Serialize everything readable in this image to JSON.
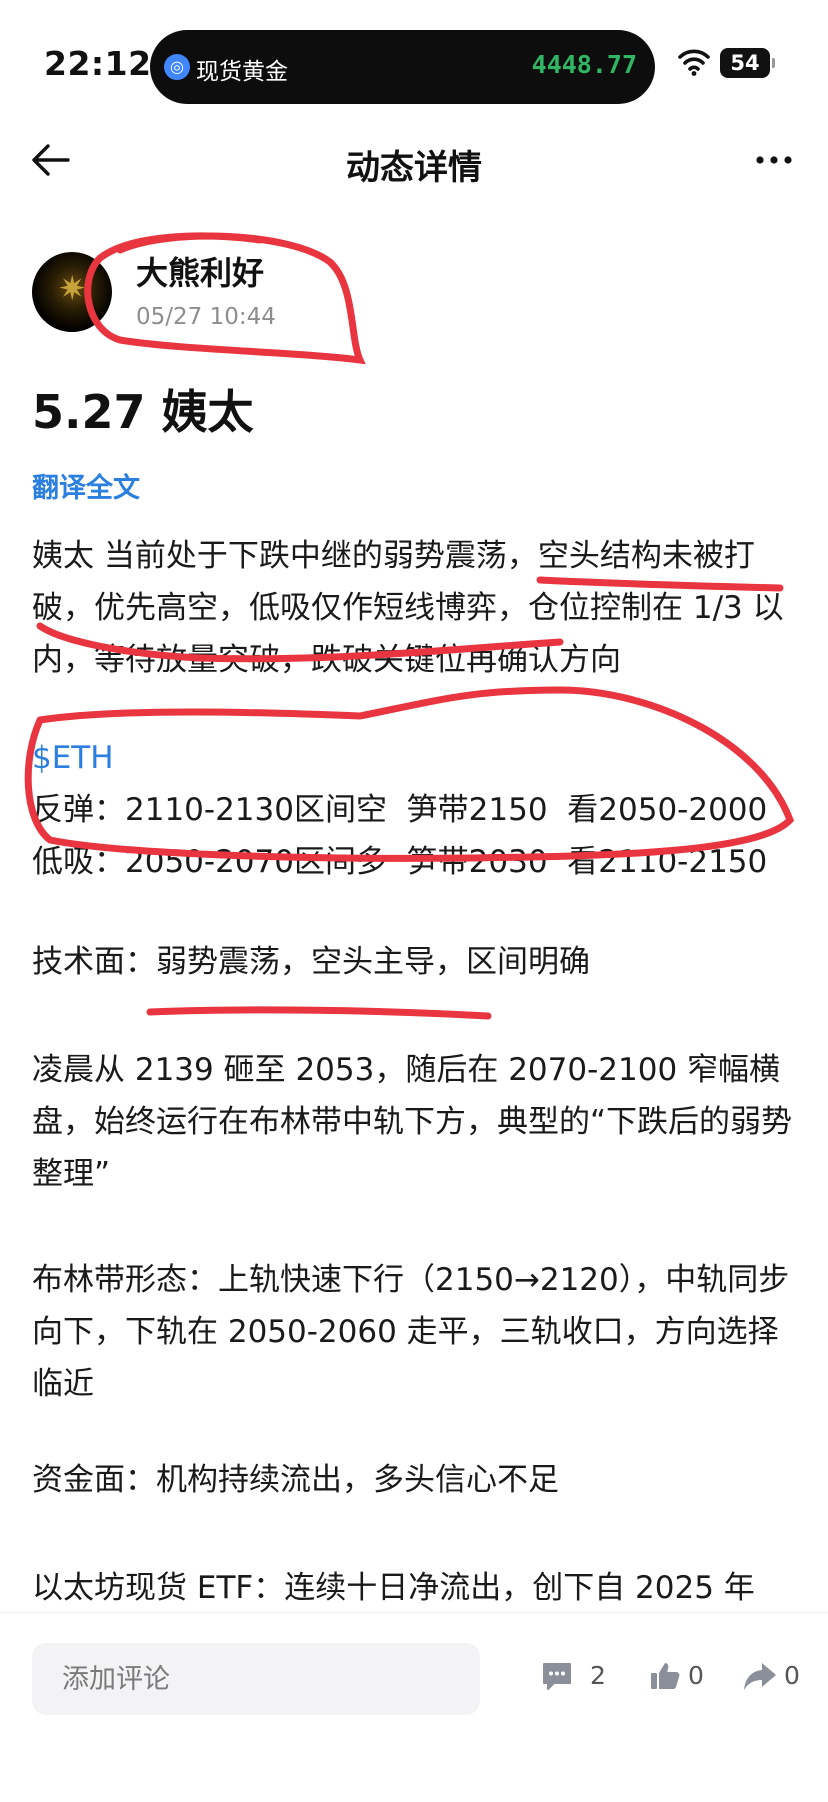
{
  "status_bar": {
    "time": "22:12",
    "island_title": "现货黄金",
    "island_price": "4448.77",
    "battery": "54"
  },
  "nav": {
    "title": "动态详情"
  },
  "author": {
    "name": "大熊利好",
    "time": "05/27 10:44"
  },
  "post": {
    "title": "5.27 姨太",
    "translate": "翻译全文",
    "intro": "姨太 当前处于下跌中继的弱势震荡，空头结构未被打破，优先高空，低吸仅作短线博弈，仓位控制在 1/3 以内，等待放量突破，跌破关键位再确认方向",
    "eth_tag": "$ETH",
    "rebound": "反弹：2110-2130区间空  笋带2150  看2050-2000",
    "low_buy": "低吸：2050-2070区间多  笋带2030  看2110-2150",
    "tech": "技术面：弱势震荡，空头主导，区间明确",
    "para1": "凌晨从 2139 砸至 2053，随后在 2070-2100 窄幅横盘，始终运行在布林带中轨下方，典型的“下跌后的弱势整理”",
    "para2": "布林带形态：上轨快速下行（2150→2120），中轨同步向下，下轨在 2050-2060 走平，三轨收口，方向选择临近",
    "para3": "资金面：机构持续流出，多头信心不足",
    "para4": "以太坊现货 ETF：连续十日净流出，创下自 2025 年"
  },
  "bottom": {
    "comment_placeholder": "添加评论",
    "comments": "2",
    "likes": "0",
    "shares": "0"
  },
  "colors": {
    "accent": "#2a7fe0",
    "price_green": "#2fb563",
    "marker_red": "#e8353f"
  }
}
